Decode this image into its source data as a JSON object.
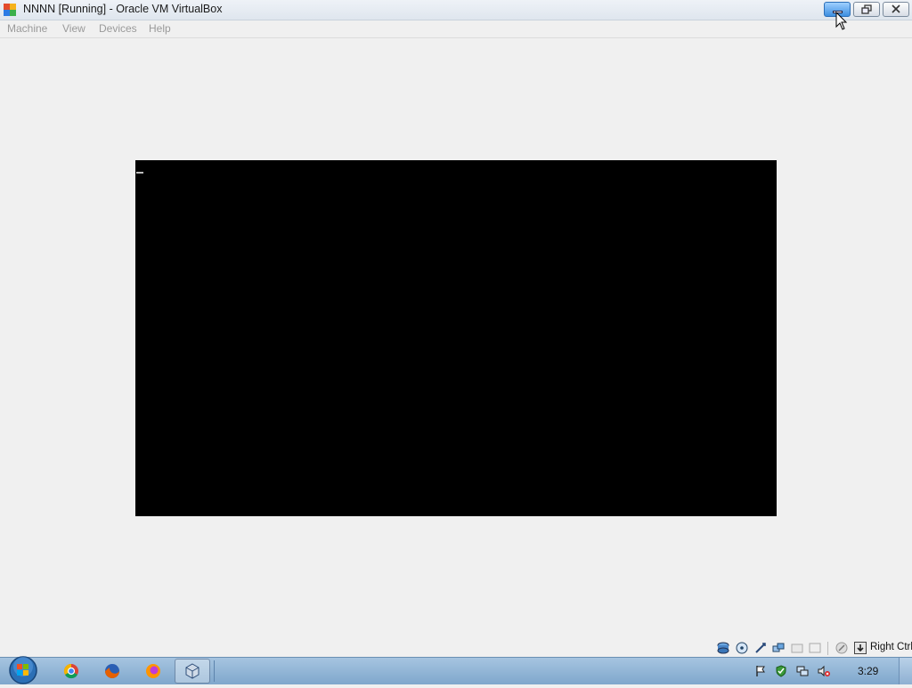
{
  "window": {
    "title": "NNNN [Running] - Oracle VM VirtualBox",
    "app_icon": "virtualbox-icon",
    "controls": [
      "minimize",
      "restore",
      "close"
    ]
  },
  "menubar": {
    "items": [
      "Machine",
      "View",
      "Devices",
      "Help"
    ]
  },
  "statusbar": {
    "icons": [
      "hard-disk-icon",
      "optical-drive-icon",
      "usb-icon",
      "network-icon",
      "shared-folders-icon",
      "display-icon",
      "mouse-integration-icon",
      "host-key-icon"
    ],
    "host_key_label": "Right Ctrl"
  },
  "taskbar": {
    "start": "windows-start-orb",
    "pinned": [
      "chrome-icon",
      "firefox-icon",
      "firefox-alt-icon",
      "virtualbox-icon"
    ],
    "tray_icons": [
      "action-center-flag-icon",
      "security-shield-icon",
      "network-icon",
      "volume-muted-icon"
    ],
    "clock": "3:29"
  }
}
